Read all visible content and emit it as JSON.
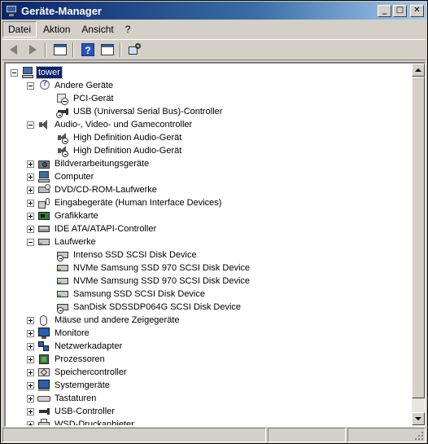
{
  "window": {
    "title": "Geräte-Manager",
    "controls": {
      "minimize": "_",
      "maximize": "□",
      "close": "✕"
    }
  },
  "menu": [
    {
      "label": "Datei",
      "active": true
    },
    {
      "label": "Aktion",
      "active": false
    },
    {
      "label": "Ansicht",
      "active": false
    },
    {
      "label": "?",
      "active": false
    }
  ],
  "toolbar": [
    {
      "icon": "back-arrow-icon"
    },
    {
      "icon": "forward-arrow-icon"
    },
    {
      "icon": "show-hide-console-tree-icon"
    },
    {
      "icon": "help-icon",
      "glyph": "?"
    },
    {
      "icon": "properties-window-icon"
    },
    {
      "icon": "scan-hardware-icon"
    }
  ],
  "tree": {
    "root": "tower",
    "nodes": [
      {
        "label": "Andere Geräte",
        "level": 1,
        "state": "expanded",
        "icon": "unknown-device-icon"
      },
      {
        "label": "PCI-Gerät",
        "level": 2,
        "state": "leaf",
        "icon": "warning-device-icon"
      },
      {
        "label": "USB (Universal Serial Bus)-Controller",
        "level": 2,
        "state": "leaf",
        "icon": "warning-usb-icon"
      },
      {
        "label": "Audio-, Video- und Gamecontroller",
        "level": 1,
        "state": "expanded",
        "icon": "speaker-icon"
      },
      {
        "label": "High Definition Audio-Gerät",
        "level": 2,
        "state": "leaf",
        "icon": "speaker-disabled-icon"
      },
      {
        "label": "High Definition Audio-Gerät",
        "level": 2,
        "state": "leaf",
        "icon": "speaker-disabled-icon"
      },
      {
        "label": "Bildverarbeitungsgeräte",
        "level": 1,
        "state": "collapsed",
        "icon": "camera-icon"
      },
      {
        "label": "Computer",
        "level": 1,
        "state": "collapsed",
        "icon": "computer-icon"
      },
      {
        "label": "DVD/CD-ROM-Laufwerke",
        "level": 1,
        "state": "collapsed",
        "icon": "dvd-drive-icon"
      },
      {
        "label": "Eingabegeräte (Human Interface Devices)",
        "level": 1,
        "state": "collapsed",
        "icon": "hid-icon"
      },
      {
        "label": "Grafikkarte",
        "level": 1,
        "state": "collapsed",
        "icon": "graphics-card-icon"
      },
      {
        "label": "IDE ATA/ATAPI-Controller",
        "level": 1,
        "state": "collapsed",
        "icon": "ide-controller-icon"
      },
      {
        "label": "Laufwerke",
        "level": 1,
        "state": "expanded",
        "icon": "disk-drive-icon"
      },
      {
        "label": "Intenso SSD SCSI Disk Device",
        "level": 2,
        "state": "leaf",
        "icon": "disk-drive-disabled-icon"
      },
      {
        "label": "NVMe Samsung SSD 970 SCSI Disk Device",
        "level": 2,
        "state": "leaf",
        "icon": "disk-drive-icon"
      },
      {
        "label": "NVMe Samsung SSD 970 SCSI Disk Device",
        "level": 2,
        "state": "leaf",
        "icon": "disk-drive-icon"
      },
      {
        "label": "Samsung SSD SCSI Disk Device",
        "level": 2,
        "state": "leaf",
        "icon": "disk-drive-icon"
      },
      {
        "label": "SanDisk SDSSDP064G SCSI Disk Device",
        "level": 2,
        "state": "leaf",
        "icon": "disk-drive-disabled-icon"
      },
      {
        "label": "Mäuse und andere Zeigegeräte",
        "level": 1,
        "state": "collapsed",
        "icon": "mouse-icon"
      },
      {
        "label": "Monitore",
        "level": 1,
        "state": "collapsed",
        "icon": "monitor-icon"
      },
      {
        "label": "Netzwerkadapter",
        "level": 1,
        "state": "collapsed",
        "icon": "network-adapter-icon"
      },
      {
        "label": "Prozessoren",
        "level": 1,
        "state": "collapsed",
        "icon": "processor-icon"
      },
      {
        "label": "Speichercontroller",
        "level": 1,
        "state": "collapsed",
        "icon": "storage-controller-icon"
      },
      {
        "label": "Systemgeräte",
        "level": 1,
        "state": "collapsed",
        "icon": "system-devices-icon"
      },
      {
        "label": "Tastaturen",
        "level": 1,
        "state": "collapsed",
        "icon": "keyboard-icon"
      },
      {
        "label": "USB-Controller",
        "level": 1,
        "state": "collapsed",
        "icon": "usb-icon"
      },
      {
        "label": "WSD-Druckanbieter",
        "level": 1,
        "state": "collapsed",
        "icon": "printer-icon"
      }
    ]
  },
  "colors": {
    "title_start": "#0a246a",
    "title_end": "#a6caf0",
    "selection": "#0a246a",
    "face": "#d4d0c8"
  }
}
